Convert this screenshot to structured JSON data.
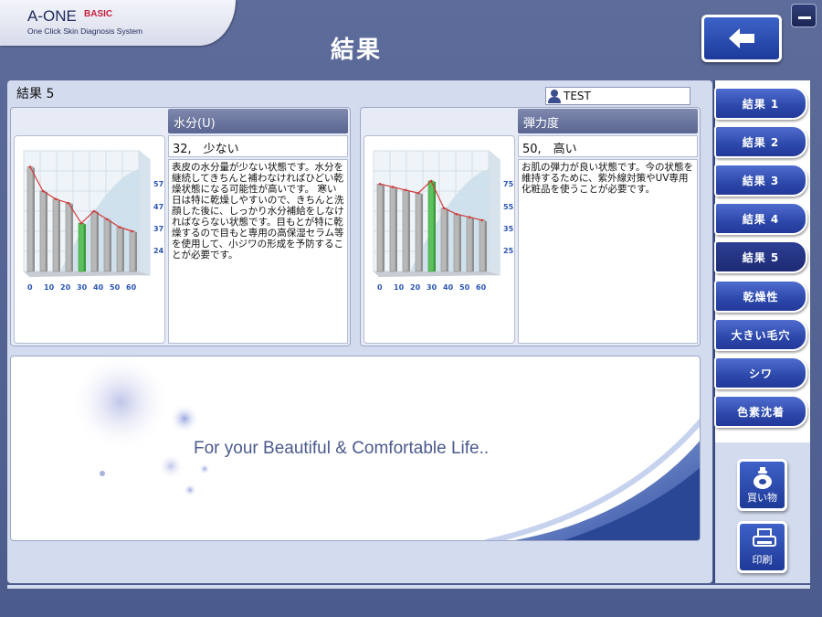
{
  "header": {
    "logo_main": "A-ONE",
    "logo_badge": "BASIC",
    "logo_sub": "One Click Skin Diagnosis System",
    "page_title": "結果"
  },
  "main": {
    "result_label": "結果 5",
    "user_name": "TEST"
  },
  "metrics": [
    {
      "title": "水分(U)",
      "value": "32,　少ない",
      "description": "表皮の水分量が少ない状態です。水分を継続してきちんと補わなければひどい乾燥状態になる可能性が高いです。 寒い日は特に乾燥しやすいので、きちんと洗顔した後に、しっかり水分補給をしなければならない状態です。目もとが特に乾燥するので目もと専用の高保湿セラム等を使用して、小ジワの形成を予防することが必要です。",
      "chart": {
        "x_labels": [
          "0",
          "10",
          "20",
          "30",
          "40",
          "50",
          "60"
        ],
        "y_ticks": [
          "57",
          "47",
          "37",
          "24"
        ],
        "bars": [
          62,
          50,
          46,
          44,
          34,
          40,
          36,
          32,
          30
        ],
        "highlight_index": 4,
        "range": [
          10,
          70
        ]
      }
    },
    {
      "title": "弾力度",
      "value": "50,　高い",
      "description": "お肌の弾力が良い状態です。今の状態を維持するために、紫外線対策やUV専用化粧品を使うことが必要です。",
      "chart": {
        "x_labels": [
          "0",
          "10",
          "20",
          "30",
          "40",
          "50",
          "60"
        ],
        "y_ticks": [
          "75",
          "55",
          "35",
          "25"
        ],
        "bars": [
          68,
          66,
          64,
          62,
          70,
          52,
          48,
          46,
          44
        ],
        "highlight_index": 4,
        "range": [
          10,
          90
        ]
      }
    }
  ],
  "banner": {
    "tagline": "For your Beautiful & Comfortable Life.."
  },
  "sidebar": {
    "items": [
      {
        "label": "結果 1",
        "active": false
      },
      {
        "label": "結果 2",
        "active": false
      },
      {
        "label": "結果 3",
        "active": false
      },
      {
        "label": "結果 4",
        "active": false
      },
      {
        "label": "結果 5",
        "active": true
      },
      {
        "label": "乾燥性",
        "active": false
      },
      {
        "label": "大きい毛穴",
        "active": false
      },
      {
        "label": "シワ",
        "active": false
      },
      {
        "label": "色素沈着",
        "active": false
      }
    ],
    "shop_label": "買い物",
    "print_label": "印刷"
  },
  "colors": {
    "highlight_bar": "#5cc05c",
    "normal_bar": "#b8b8b8",
    "trend_line": "#d33a3a"
  }
}
